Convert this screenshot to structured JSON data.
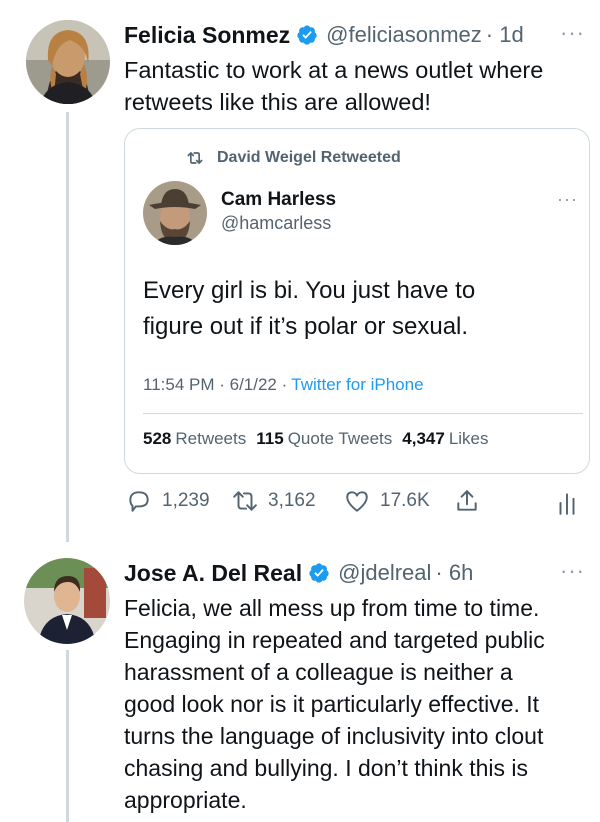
{
  "tweet1": {
    "name": "Felicia Sonmez",
    "handle": "@feliciasonmez",
    "time": "· 1d",
    "more": "···",
    "text_lines": [
      "Fantastic to work at a news outlet where",
      "retweets like this are allowed!"
    ],
    "actions": {
      "replies": "1,239",
      "retweets": "3,162",
      "likes": "17.6K"
    }
  },
  "quoted": {
    "retweeted_by": "David Weigel Retweeted",
    "name": "Cam Harless",
    "handle": "@hamcarless",
    "more": "···",
    "text_lines": [
      "Every girl is bi. You just have to",
      "figure out if it’s polar or sexual."
    ],
    "time": "11:54 PM · 6/1/22 · ",
    "source": "Twitter for iPhone",
    "stats": {
      "retweets_count": "528",
      "retweets_label": "Retweets",
      "quotes_count": "115",
      "quotes_label": "Quote Tweets",
      "likes_count": "4,347",
      "likes_label": "Likes"
    }
  },
  "tweet2": {
    "name": "Jose A. Del Real",
    "handle": "@jdelreal",
    "time": "· 6h",
    "more": "···",
    "text_lines": [
      "Felicia, we all mess up from time to time.",
      "Engaging in repeated and targeted public",
      "harassment of a colleague is neither a",
      "good look nor is it particularly effective. It",
      "turns the language of inclusivity into clout",
      "chasing and bullying. I don’t think this is",
      "appropriate."
    ]
  },
  "colors": {
    "verified": "#1d9bf0",
    "link": "#1d9bf0",
    "secondary": "#536471",
    "border": "#cfd9de"
  }
}
